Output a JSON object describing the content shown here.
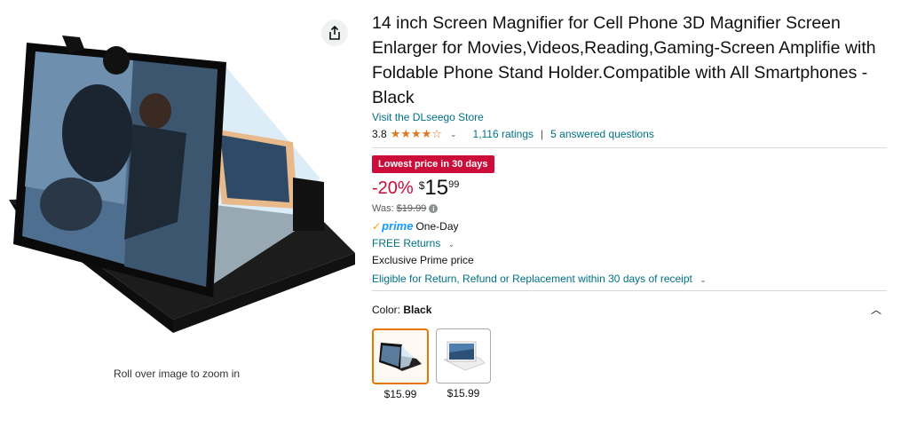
{
  "gallery": {
    "zoom_hint": "Roll over image to zoom in",
    "share_icon": "share-icon"
  },
  "product": {
    "title": "14 inch Screen Magnifier for Cell Phone 3D Magnifier Screen Enlarger for Movies,Videos,Reading,Gaming-Screen Amplifie with Foldable Phone Stand Holder.Compatible with All Smartphones -Black",
    "store_link": "Visit the DLseego Store",
    "rating_value": "3.8",
    "rating_count": "1,116 ratings",
    "answered_questions": "5 answered questions",
    "star_color": "#de7921"
  },
  "pricing": {
    "badge": "Lowest price in 30 days",
    "badge_color": "#cc0c39",
    "discount": "-20%",
    "currency": "$",
    "whole": "15",
    "fraction": "99",
    "was_label": "Was:",
    "was_price": "$19.99"
  },
  "delivery": {
    "prime_label": "prime",
    "one_day": "One-Day",
    "free_returns": "FREE Returns",
    "exclusive": "Exclusive Prime price",
    "eligible": "Eligible for Return, Refund or Replacement within 30 days of receipt"
  },
  "variants": {
    "color_label": "Color:",
    "color_value": "Black",
    "options": [
      {
        "name": "Black",
        "price": "$15.99",
        "selected": true
      },
      {
        "name": "White",
        "price": "$15.99",
        "selected": false
      }
    ]
  }
}
